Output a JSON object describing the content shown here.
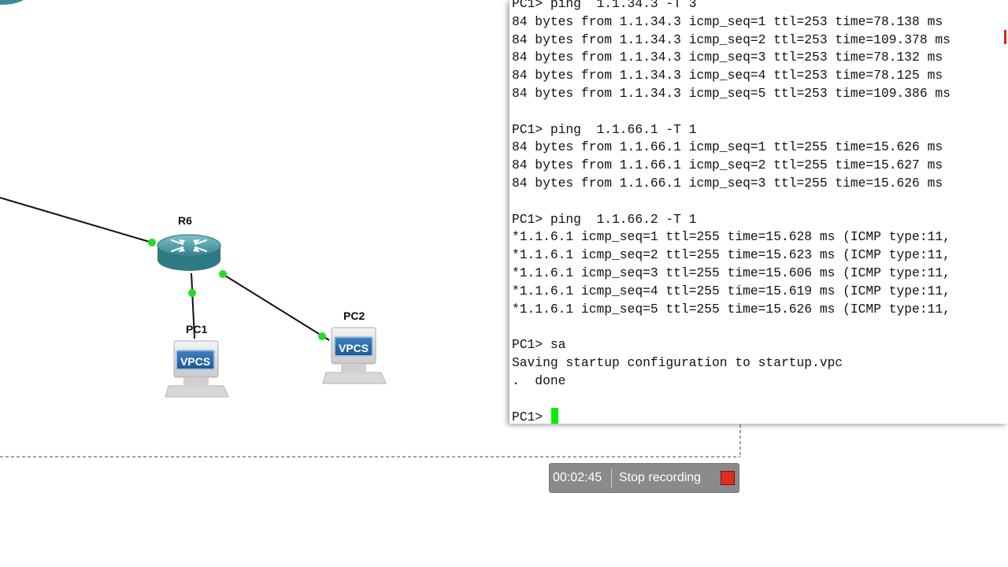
{
  "topology": {
    "router": {
      "name": "R6"
    },
    "hosts": [
      {
        "name": "PC1",
        "type": "VPCS"
      },
      {
        "name": "PC2",
        "type": "VPCS"
      }
    ]
  },
  "terminal": {
    "lines": [
      "PC1> ping  1.1.34.3 -T 3",
      "84 bytes from 1.1.34.3 icmp_seq=1 ttl=253 time=78.138 ms",
      "84 bytes from 1.1.34.3 icmp_seq=2 ttl=253 time=109.378 ms",
      "84 bytes from 1.1.34.3 icmp_seq=3 ttl=253 time=78.132 ms",
      "84 bytes from 1.1.34.3 icmp_seq=4 ttl=253 time=78.125 ms",
      "84 bytes from 1.1.34.3 icmp_seq=5 ttl=253 time=109.386 ms",
      "",
      "PC1> ping  1.1.66.1 -T 1",
      "84 bytes from 1.1.66.1 icmp_seq=1 ttl=255 time=15.626 ms",
      "84 bytes from 1.1.66.1 icmp_seq=2 ttl=255 time=15.627 ms",
      "84 bytes from 1.1.66.1 icmp_seq=3 ttl=255 time=15.626 ms",
      "",
      "PC1> ping  1.1.66.2 -T 1",
      "*1.1.6.1 icmp_seq=1 ttl=255 time=15.628 ms (ICMP type:11,",
      "*1.1.6.1 icmp_seq=2 ttl=255 time=15.623 ms (ICMP type:11,",
      "*1.1.6.1 icmp_seq=3 ttl=255 time=15.606 ms (ICMP type:11,",
      "*1.1.6.1 icmp_seq=4 ttl=255 time=15.619 ms (ICMP type:11,",
      "*1.1.6.1 icmp_seq=5 ttl=255 time=15.626 ms (ICMP type:11,",
      "",
      "PC1> sa",
      "Saving startup configuration to startup.vpc",
      ".  done",
      ""
    ],
    "prompt": "PC1> "
  },
  "recording": {
    "elapsed": "00:02:45",
    "stop_label": "Stop recording",
    "stop_color": "#e02b20"
  },
  "colors": {
    "link_dot": "#22dd22",
    "cursor": "#00ee00",
    "router_body": "#4a9ca6"
  }
}
